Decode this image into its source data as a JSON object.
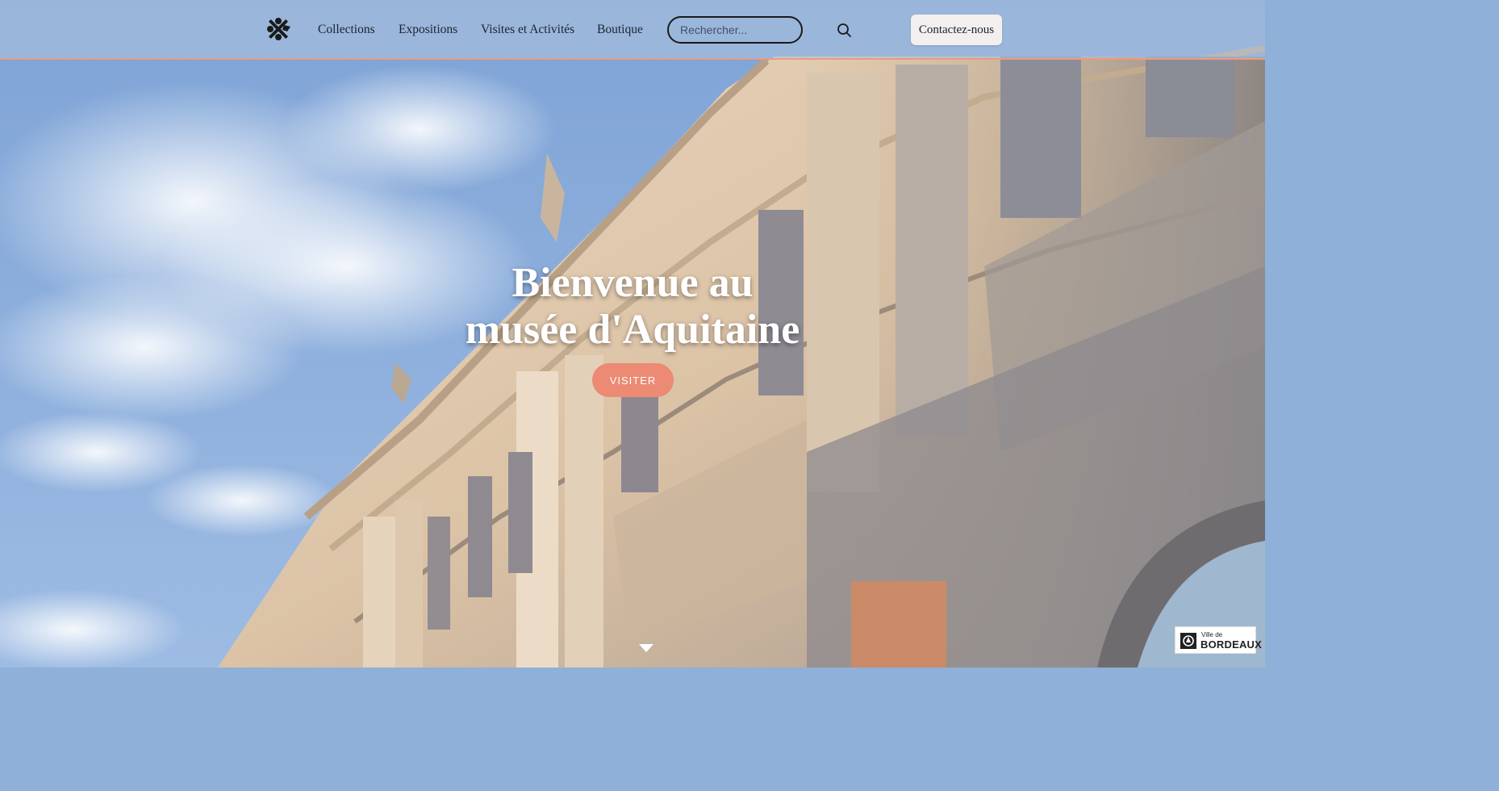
{
  "header": {
    "logo_icon": "museum-cross-logo-icon",
    "nav": [
      {
        "label": "Collections"
      },
      {
        "label": "Expositions"
      },
      {
        "label": "Visites et Activités"
      },
      {
        "label": "Boutique"
      }
    ],
    "search": {
      "placeholder": "Rechercher...",
      "icon": "search-icon"
    },
    "contact_label": "Contactez-nous",
    "border_color": "#e79b84"
  },
  "hero": {
    "title_line1": "Bienvenue au",
    "title_line2": "musée d'Aquitaine",
    "visit_label": "VISITER",
    "scroll_icon": "triangle-down-icon",
    "accent_color": "#ec8a74"
  },
  "badge": {
    "small": "Ville de",
    "big": "BORDEAUX",
    "icon": "bordeaux-city-icon"
  }
}
